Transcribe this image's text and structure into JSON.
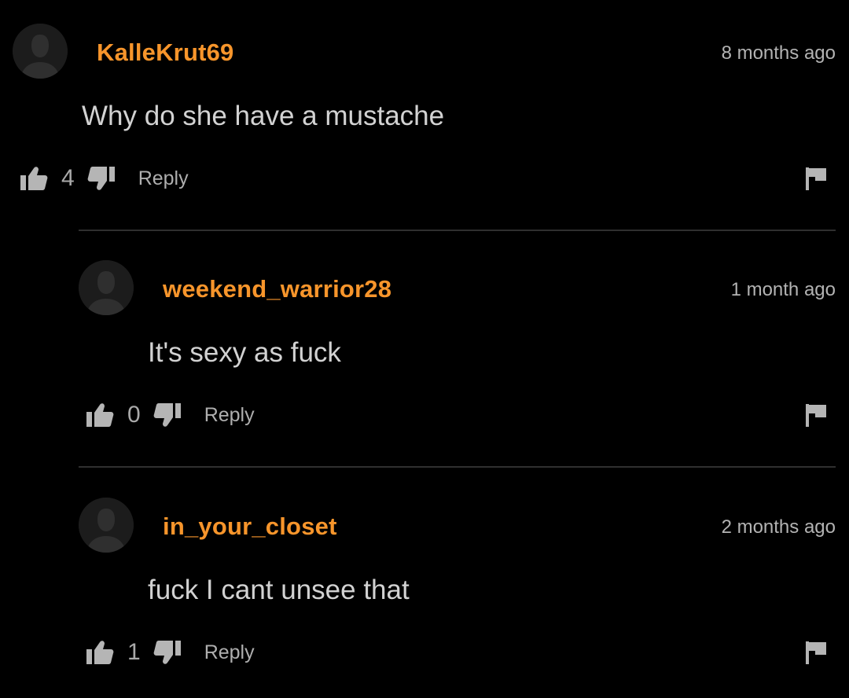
{
  "comments": [
    {
      "username": "KalleKrut69",
      "timestamp": "8 months ago",
      "text": "Why do she have a mustache",
      "likes": "4",
      "reply_label": "Reply"
    },
    {
      "username": "weekend_warrior28",
      "timestamp": "1 month ago",
      "text": "It's sexy as fuck",
      "likes": "0",
      "reply_label": "Reply"
    },
    {
      "username": "in_your_closet",
      "timestamp": "2 months ago",
      "text": "fuck I cant unsee that",
      "likes": "1",
      "reply_label": "Reply"
    }
  ],
  "icons": {
    "avatar": "default-avatar-icon",
    "like": "thumbs-up-icon",
    "dislike": "thumbs-down-icon",
    "report": "flag-icon"
  },
  "colors": {
    "background": "#000000",
    "username": "#f7952b",
    "text": "#d2d2d2",
    "muted": "#b3b3b3",
    "divider": "#2f2f2f"
  }
}
